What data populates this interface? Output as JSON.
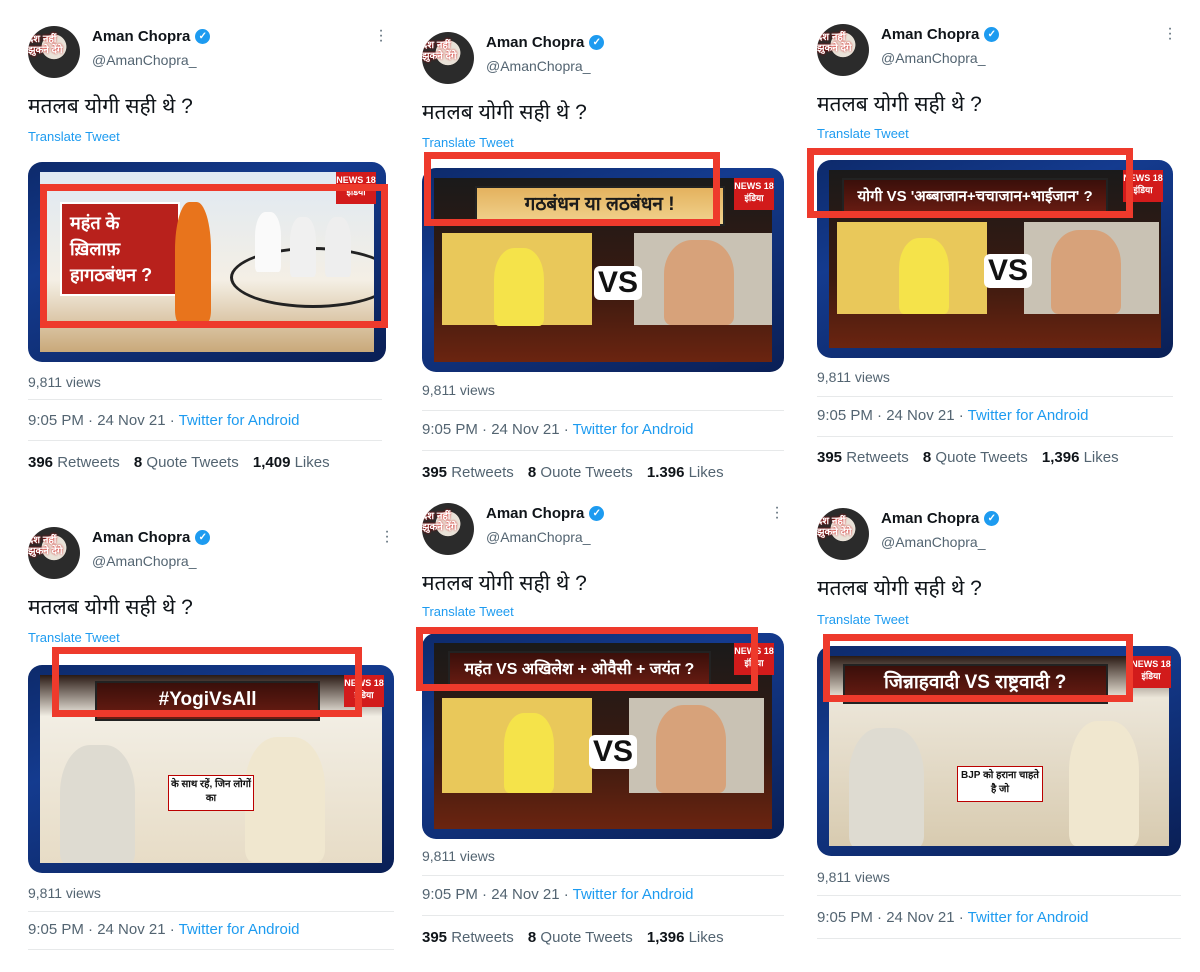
{
  "tweets": [
    {
      "name": "Aman Chopra",
      "handle": "@AmanChopra_",
      "avatar_text": "देश नहीं झुकने देंगे",
      "text": "मतलब योगी सही थे ?",
      "translate": "Translate Tweet",
      "media_headline": "महंत के ख़िलाफ़ हागठबंधन ?",
      "views": "9,811 views",
      "time": "9:05 PM · 24 Nov 21 · ",
      "source": "Twitter for Android",
      "retweets_count": "396",
      "retweets_label": "Retweets",
      "quotes_count": "8",
      "quotes_label": "Quote Tweets",
      "likes_count": "1,409",
      "likes_label": "Likes"
    },
    {
      "name": "Aman Chopra",
      "handle": "@AmanChopra_",
      "avatar_text": "देश नहीं झुकने देंगे",
      "text": "मतलब योगी सही थे ?",
      "translate": "Translate Tweet",
      "media_headline": "गठबंधन या लठबंधन !",
      "vs": "VS",
      "views": "9,811 views",
      "time": "9:05 PM · 24 Nov 21 · ",
      "source": "Twitter for Android",
      "retweets_count": "395",
      "retweets_label": "Retweets",
      "quotes_count": "8",
      "quotes_label": "Ouote Tweets",
      "likes_count": "1.396",
      "likes_label": "Likes"
    },
    {
      "name": "Aman Chopra",
      "handle": "@AmanChopra_",
      "avatar_text": "देश नहीं झुकने देंगे",
      "text": "मतलब योगी सही थे ?",
      "translate": "Translate Tweet",
      "media_headline": "योगी VS 'अब्बाजान+चचाजान+भाईजान' ?",
      "vs": "VS",
      "views": "9,811 views",
      "time": "9:05 PM · 24 Nov 21 · ",
      "source": "Twitter for Android",
      "retweets_count": "395",
      "retweets_label": "Retweets",
      "quotes_count": "8",
      "quotes_label": "Quote Tweets",
      "likes_count": "1,396",
      "likes_label": "Likes"
    },
    {
      "name": "Aman Chopra",
      "handle": "@AmanChopra_",
      "avatar_text": "देश नहीं झुकने देंगे",
      "text": "मतलब योगी सही थे ?",
      "translate": "Translate Tweet",
      "media_headline": "#YogiVsAll",
      "media_caption": "के साथ रहें, जिन लोगों का",
      "views": "9,811 views",
      "time": "9:05 PM · 24 Nov 21 · ",
      "source": "Twitter for Android"
    },
    {
      "name": "Aman Chopra",
      "handle": "@AmanChopra_",
      "avatar_text": "देश नहीं झुकने देंगे",
      "text": "मतलब योगी सही थे ?",
      "translate": "Translate Tweet",
      "media_headline": "महंत VS अखिलेश + ओवैसी + जयंत ?",
      "vs": "VS",
      "views": "9,811 views",
      "time": "9:05 PM · 24 Nov 21 · ",
      "source": "Twitter for Android",
      "retweets_count": "395",
      "retweets_label": "Retweets",
      "quotes_count": "8",
      "quotes_label": "Quote Tweets",
      "likes_count": "1,396",
      "likes_label": "Likes"
    },
    {
      "name": "Aman Chopra",
      "handle": "@AmanChopra_",
      "avatar_text": "देश नहीं झुकने देंगे",
      "text": "मतलब योगी सही थे ?",
      "translate": "Translate Tweet",
      "media_headline": "जिन्नाहवादी VS राष्ट्रवादी ?",
      "media_caption": "BJP को हराना चाहते है जो",
      "views": "9,811 views",
      "time": "9:05 PM · 24 Nov 21 · ",
      "source": "Twitter for Android"
    }
  ],
  "news_logo": "NEWS 18 इंडिया",
  "colors": {
    "accent": "#1d9bf0",
    "highlight_box": "#ee3a2c",
    "muted": "#536471"
  }
}
